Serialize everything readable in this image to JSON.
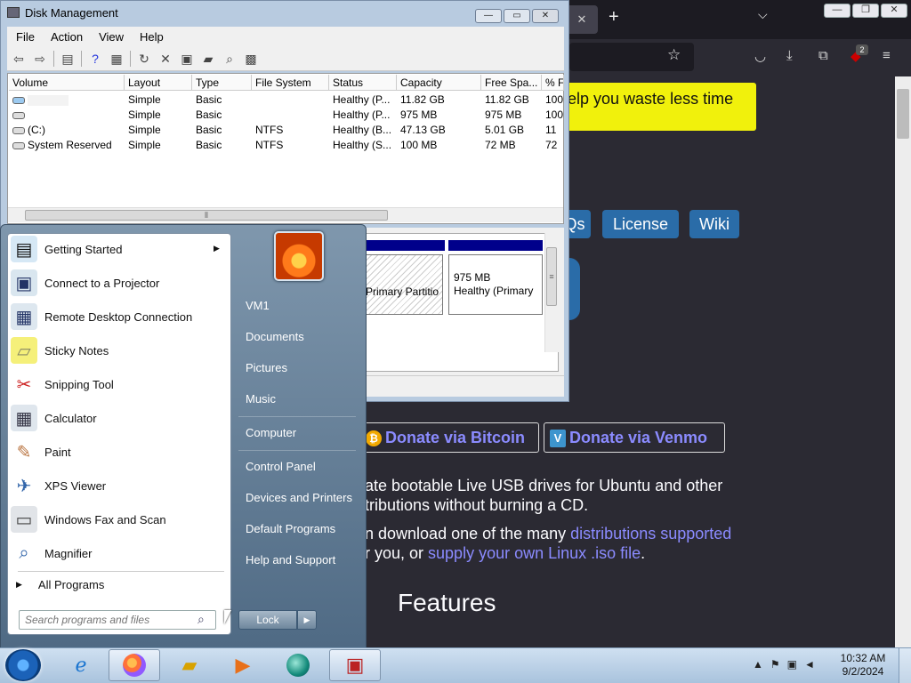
{
  "firefox": {
    "tab_close": "✕",
    "newtab": "+",
    "list_tabs": "⌵",
    "banner_text": "elp you waste less time",
    "buttons": [
      "Qs",
      "License",
      "Wiki"
    ],
    "donate_bitcoin": "Donate via Bitcoin",
    "donate_venmo": "Donate via Venmo",
    "para1_line1": "ate bootable Live USB drives for Ubuntu and other",
    "para1_line2": "tributions without burning a CD.",
    "para2_line1_pre": "n download one of the many ",
    "para2_link1": "distributions supported",
    "para2_line2_pre": "r you, or ",
    "para2_link2": "supply your own Linux .iso file",
    "para2_line2_post": ".",
    "features": "Features",
    "badge_count": "2"
  },
  "disk_mgmt": {
    "title": "Disk Management",
    "menu": [
      "File",
      "Action",
      "View",
      "Help"
    ],
    "columns": [
      "Volume",
      "Layout",
      "Type",
      "File System",
      "Status",
      "Capacity",
      "Free Spa...",
      "% F"
    ],
    "rows": [
      {
        "volume": "",
        "layout": "Simple",
        "type": "Basic",
        "fs": "",
        "status": "Healthy (P...",
        "capacity": "11.82 GB",
        "free": "11.82 GB",
        "pct": "100"
      },
      {
        "volume": "",
        "layout": "Simple",
        "type": "Basic",
        "fs": "",
        "status": "Healthy (P...",
        "capacity": "975 MB",
        "free": "975 MB",
        "pct": "100"
      },
      {
        "volume": "(C:)",
        "layout": "Simple",
        "type": "Basic",
        "fs": "NTFS",
        "status": "Healthy (B...",
        "capacity": "47.13 GB",
        "free": "5.01 GB",
        "pct": "11"
      },
      {
        "volume": "System Reserved",
        "layout": "Simple",
        "type": "Basic",
        "fs": "NTFS",
        "status": "Healthy (S...",
        "capacity": "100 MB",
        "free": "72 MB",
        "pct": "72"
      }
    ],
    "part1_label": "Primary Partitio",
    "part2_size": "975 MB",
    "part2_status": "Healthy (Primary"
  },
  "start_menu": {
    "apps": [
      "Getting Started",
      "Connect to a Projector",
      "Remote Desktop Connection",
      "Sticky Notes",
      "Snipping Tool",
      "Calculator",
      "Paint",
      "XPS Viewer",
      "Windows Fax and Scan",
      "Magnifier"
    ],
    "all_programs": "All Programs",
    "search_placeholder": "Search programs and files",
    "right_items": [
      "VM1",
      "Documents",
      "Pictures",
      "Music",
      "Computer",
      "Control Panel",
      "Devices and Printers",
      "Default Programs",
      "Help and Support"
    ],
    "lock": "Lock"
  },
  "taskbar": {
    "time": "10:32 AM",
    "date": "9/2/2024"
  },
  "colors": {
    "banner": "#f1f10c",
    "link": "#8b8bff",
    "ff_bg": "#2b2a33",
    "button_blue": "#2a6ca8"
  }
}
